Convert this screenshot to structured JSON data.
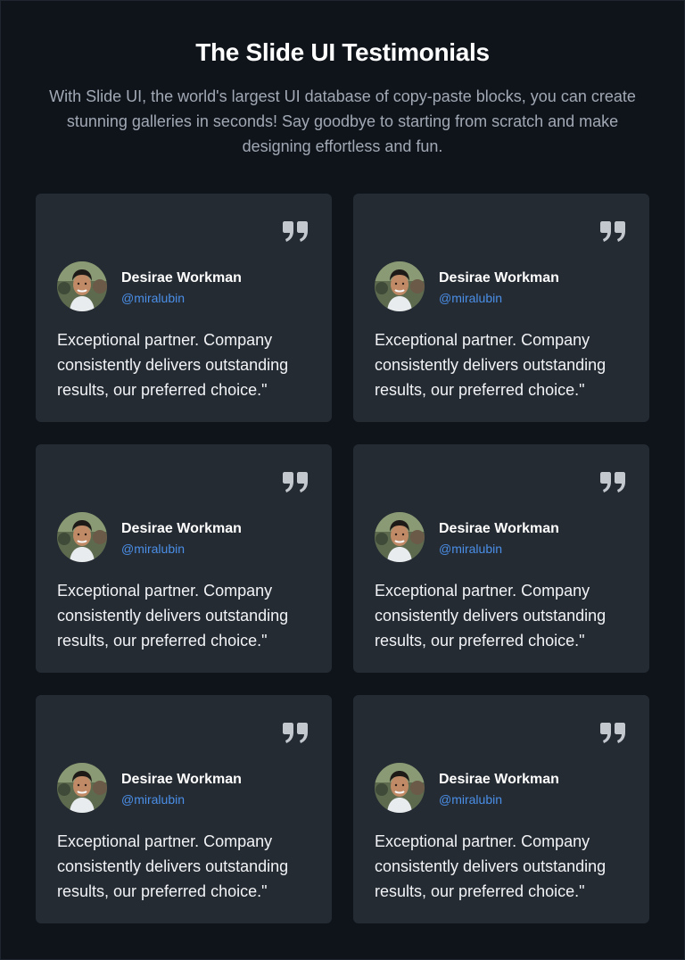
{
  "header": {
    "title": "The Slide UI Testimonials",
    "subtitle": "With Slide UI, the world's largest UI database of copy-paste blocks, you can create stunning galleries in seconds! Say goodbye to starting from scratch and make designing effortless and fun."
  },
  "testimonials": [
    {
      "name": "Desirae Workman",
      "handle": "@miralubin",
      "text": "Exceptional partner. Company consistently delivers outstanding results, our preferred choice.\""
    },
    {
      "name": "Desirae Workman",
      "handle": "@miralubin",
      "text": "Exceptional partner. Company consistently delivers outstanding results, our preferred choice.\""
    },
    {
      "name": "Desirae Workman",
      "handle": "@miralubin",
      "text": "Exceptional partner. Company consistently delivers outstanding results, our preferred choice.\""
    },
    {
      "name": "Desirae Workman",
      "handle": "@miralubin",
      "text": "Exceptional partner. Company consistently delivers outstanding results, our preferred choice.\""
    },
    {
      "name": "Desirae Workman",
      "handle": "@miralubin",
      "text": "Exceptional partner. Company consistently delivers outstanding results, our preferred choice.\""
    },
    {
      "name": "Desirae Workman",
      "handle": "@miralubin",
      "text": "Exceptional partner. Company consistently delivers outstanding results, our preferred choice.\""
    }
  ],
  "icons": {
    "quote": "closing-quote-icon",
    "avatar": "avatar-photo"
  },
  "colors": {
    "background": "#0f141b",
    "card": "#252b33",
    "handle": "#4a8fe8",
    "quote_icon": "#c3c8cf"
  }
}
